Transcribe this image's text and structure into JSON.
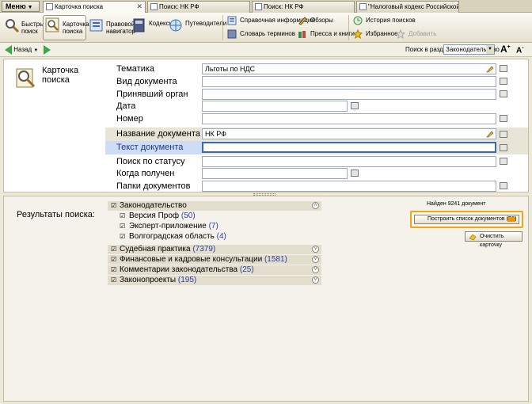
{
  "tabs": {
    "menu_label": "Меню",
    "items": [
      {
        "label": "Карточка поиска"
      },
      {
        "label": "Поиск: НК РФ"
      },
      {
        "label": "Поиск: НК РФ"
      },
      {
        "label": "\"Налоговый кодекс Российской Фед..."
      }
    ]
  },
  "toolbar": {
    "quick_search": "Быстрый\nпоиск",
    "search_card": "Карточка\nпоиска",
    "legal_navigator": "Правовой\nнавигатор",
    "codes": "Кодексы",
    "guides": "Путеводители",
    "reference_info": "Справочная информация",
    "glossary": "Словарь терминов",
    "reviews": "Обзоры",
    "press_books": "Пресса и книги",
    "search_history": "История поисков",
    "favorites": "Избранное",
    "add": "Добавить"
  },
  "navbar": {
    "back_label": "Назад",
    "search_in_label": "Поиск в разделе",
    "section_value": "Законодательство"
  },
  "card": {
    "title": "Карточка\nпоиска",
    "fields": [
      {
        "label": "Тематика",
        "value": "Льготы по НДС"
      },
      {
        "label": "Вид документа",
        "value": ""
      },
      {
        "label": "Принявший орган",
        "value": ""
      },
      {
        "label": "Дата",
        "value": ""
      },
      {
        "label": "Номер",
        "value": ""
      },
      {
        "label": "Название документа",
        "value": "НК РФ"
      },
      {
        "label": "Текст документа",
        "value": ""
      },
      {
        "label": "Поиск по статусу",
        "value": ""
      },
      {
        "label": "Когда получен",
        "value": ""
      },
      {
        "label": "Папки документов",
        "value": ""
      }
    ]
  },
  "results": {
    "label": "Результаты поиска:",
    "found": "Найден 9241 документ",
    "build_button": "Построить список документов (F9)",
    "clear_button": "Очистить карточку",
    "groups": [
      {
        "name": "Законодательство",
        "count": ""
      },
      {
        "name": "Версия Проф",
        "count": "(50)"
      },
      {
        "name": "Эксперт-приложение",
        "count": "(7)"
      },
      {
        "name": "Волгоградская область",
        "count": "(4)"
      },
      {
        "name": "Судебная практика",
        "count": "(7379)"
      },
      {
        "name": "Финансовые и кадровые консультации",
        "count": "(1581)"
      },
      {
        "name": "Комментарии законодательства",
        "count": "(25)"
      },
      {
        "name": "Законопроекты",
        "count": "(195)"
      }
    ]
  },
  "colors": {
    "accent_orange": "#f5a21b",
    "count_blue": "#2b3ea0",
    "focus_blue": "#316ac5"
  }
}
